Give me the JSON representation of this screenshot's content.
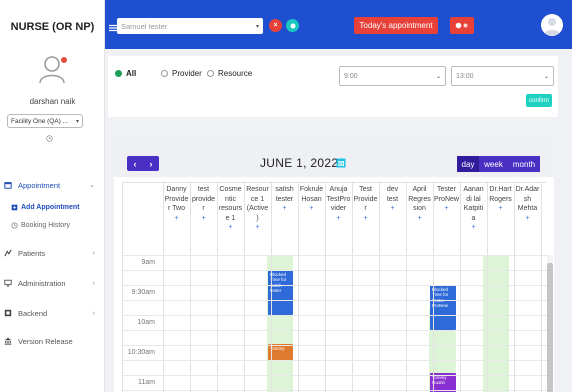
{
  "sidebar": {
    "role_title": "NURSE (OR NP)",
    "user_name": "darshan naik",
    "facility": "Facility One (QA) ...",
    "nav": {
      "appointment": "Appointment",
      "add_appointment": "Add Appointment",
      "booking_history": "Booking History",
      "patients": "Patients",
      "administration": "Administration",
      "backend": "Backend",
      "version_release": "Version Release"
    }
  },
  "topbar": {
    "patient_value": "Samuel tester",
    "todays_appointment": "Today's appointment",
    "accent_color": "#1e4fd1",
    "alert_color": "#e8413a"
  },
  "filters": {
    "radio_all": "All",
    "radio_provider": "Provider",
    "radio_resource": "Resource",
    "selected": "All",
    "start_time": "9:00",
    "end_time": "13:00",
    "confirm": "confirm"
  },
  "calendar": {
    "date_title": "JUNE 1, 2022",
    "prev": "‹",
    "next": "›",
    "views": [
      "day",
      "week",
      "month"
    ],
    "active_view": "day",
    "times": [
      "9am",
      "9:30am",
      "10am",
      "10:30am",
      "11am"
    ],
    "columns": [
      {
        "lines": [
          "Danny",
          "Provide",
          "r Two"
        ]
      },
      {
        "lines": [
          "test",
          "provide",
          "r"
        ]
      },
      {
        "lines": [
          "Cosme",
          "ntic",
          "resours",
          "e 1"
        ]
      },
      {
        "lines": [
          "Resour",
          "ce 1",
          "(Active",
          ")"
        ]
      },
      {
        "lines": [
          "satish",
          "tester"
        ]
      },
      {
        "lines": [
          "Fokrule",
          "Hosan"
        ]
      },
      {
        "lines": [
          "Anuja",
          "TestPro",
          "vider"
        ]
      },
      {
        "lines": [
          "Test",
          "Provide",
          "r"
        ]
      },
      {
        "lines": [
          "dev",
          "test"
        ]
      },
      {
        "lines": [
          "April",
          "Regres",
          "sion"
        ]
      },
      {
        "lines": [
          "Tester",
          "ProNew"
        ]
      },
      {
        "lines": [
          "Aanan",
          "di lal",
          "Katpiti",
          "a"
        ]
      },
      {
        "lines": [
          "Dr.Hart",
          "Rogers"
        ]
      },
      {
        "lines": [
          "Dr.Adar",
          "sh",
          "Mehta"
        ]
      }
    ],
    "plus": "+",
    "events": [
      {
        "text": "Blocked Time for satish tester",
        "color": "#2f6ad9"
      },
      {
        "text": "Blocked Time for Tester ProNew",
        "color": "#2f6ad9"
      },
      {
        "text": "Tommy",
        "color": "#e07a2e"
      },
      {
        "text": "Tommy Gustin",
        "color": "#8a2fd1"
      }
    ]
  }
}
